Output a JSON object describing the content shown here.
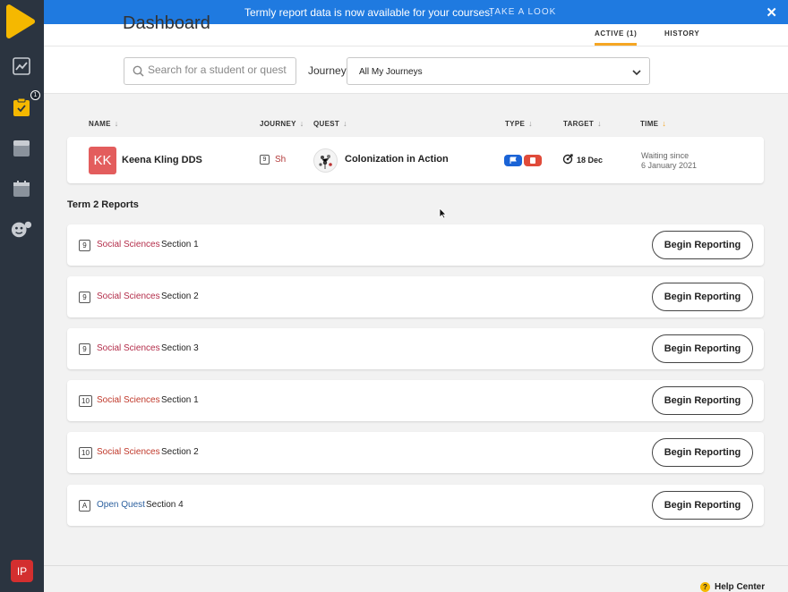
{
  "banner": {
    "message": "Termly report data is now available for your courses!",
    "link": "TAKE A LOOK",
    "close": "✕"
  },
  "sidebar": {
    "badge_count": "1",
    "user_initials": "IP",
    "icons": [
      "analytics-icon",
      "quests-icon",
      "reports-icon",
      "calendar-icon",
      "students-icon"
    ]
  },
  "header": {
    "title": "Dashboard",
    "tabs": [
      {
        "label": "ACTIVE (1)",
        "active": true
      },
      {
        "label": "HISTORY",
        "active": false
      }
    ],
    "search_placeholder": "Search for a student or quest",
    "journey_label": "Journey",
    "journey_value": "All My Journeys"
  },
  "table": {
    "columns": [
      "NAME",
      "JOURNEY",
      "QUEST",
      "TYPE",
      "TARGET",
      "TIME"
    ],
    "sort_arrows": [
      "↓",
      "↓",
      "↓",
      "↓",
      "↓",
      "↓"
    ],
    "row": {
      "initials": "KK",
      "name": "Keena Kling DDS",
      "grade": "9",
      "journey": "Sh",
      "quest": "Colonization in Action",
      "target": "18 Dec",
      "time_line1": "Waiting since",
      "time_line2": "6 January 2021"
    }
  },
  "reports": {
    "title": "Term 2 Reports",
    "button_label": "Begin Reporting",
    "items": [
      {
        "grade": "9",
        "subject": "Social Sciences",
        "section": "Section 1"
      },
      {
        "grade": "9",
        "subject": "Social Sciences",
        "section": "Section 2"
      },
      {
        "grade": "9",
        "subject": "Social Sciences",
        "section": "Section 3"
      },
      {
        "grade": "10",
        "subject": "Social Sciences",
        "section": "Section 1"
      },
      {
        "grade": "10",
        "subject": "Social Sciences",
        "section": "Section 2"
      },
      {
        "grade": "A",
        "subject": "Open Quest",
        "section": "Section 4"
      }
    ]
  },
  "footer": {
    "help": "Help Center",
    "help_icon_glyph": "?"
  },
  "colors": {
    "banner": "#1f7ae0",
    "accent": "#f5a623",
    "social_sciences": "#b32d4a",
    "grade10_subject": "#c0392b",
    "open_quest": "#2b5f9e"
  }
}
